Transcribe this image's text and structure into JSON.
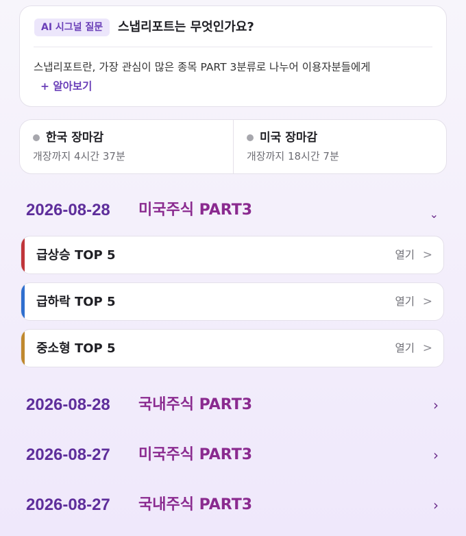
{
  "ai_card": {
    "badge": "AI 시그널 질문",
    "title": "스냅리포트는 무엇인가요?",
    "description": "스냅리포트란, 가장 관심이 많은 종목 PART 3분류로 나누어 이용자분들에게",
    "more": "+ 알아보기"
  },
  "markets": [
    {
      "name": "한국 장마감",
      "sub": "개장까지 4시간 37분"
    },
    {
      "name": "미국 장마감",
      "sub": "개장까지 18시간 7분"
    }
  ],
  "expanded_section": {
    "date": "2026-08-28",
    "market": "미국주식 PART3",
    "chevron": "⌄",
    "items": [
      {
        "title": "급상승 TOP 5",
        "open": "열기",
        "arrow": ">",
        "color": "#c0353a"
      },
      {
        "title": "급하락 TOP 5",
        "open": "열기",
        "arrow": ">",
        "color": "#2f6fcf"
      },
      {
        "title": "중소형 TOP 5",
        "open": "열기",
        "arrow": ">",
        "color": "#c0892f"
      }
    ]
  },
  "collapsed_sections": [
    {
      "date": "2026-08-28",
      "market": "국내주식 PART3",
      "chevron": "›"
    },
    {
      "date": "2026-08-27",
      "market": "미국주식 PART3",
      "chevron": "›"
    },
    {
      "date": "2026-08-27",
      "market": "국내주식 PART3",
      "chevron": "›"
    }
  ]
}
